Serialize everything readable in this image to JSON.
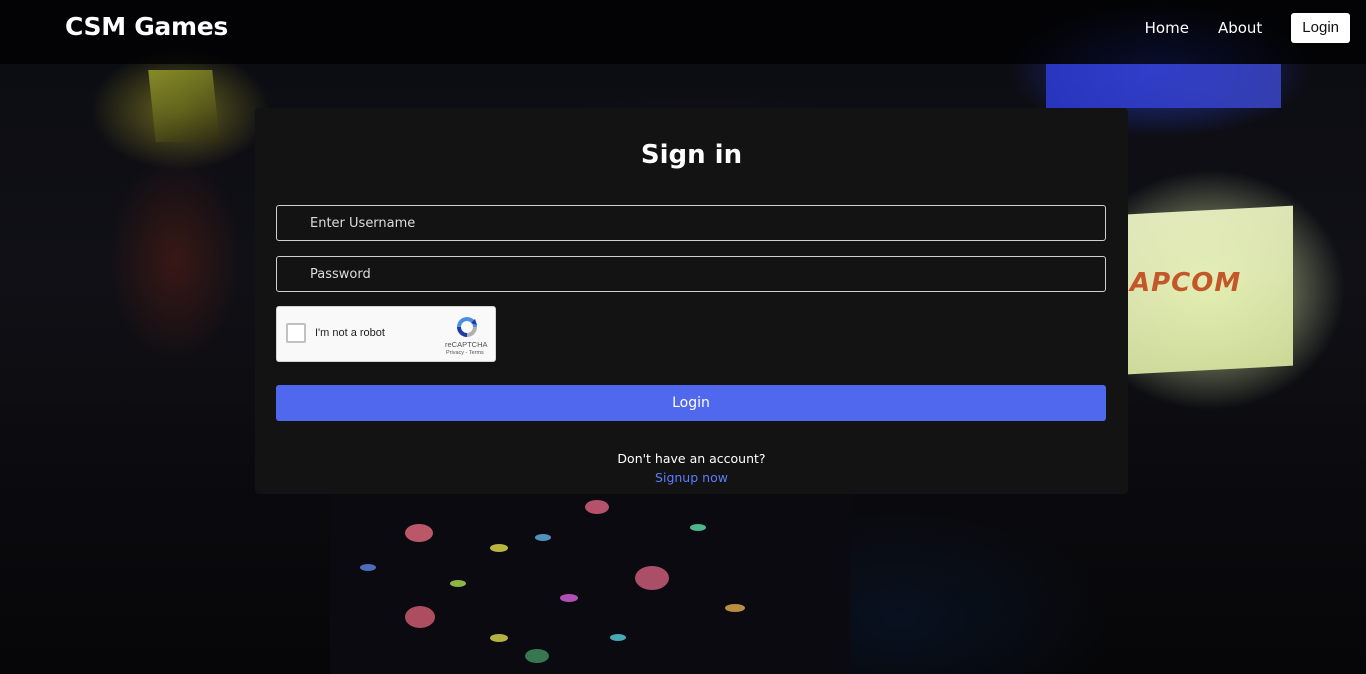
{
  "navbar": {
    "brand": "CSM Games",
    "links": [
      {
        "label": "Home"
      },
      {
        "label": "About"
      }
    ],
    "login_button": "Login"
  },
  "background": {
    "screen_text": "APCOM"
  },
  "signin": {
    "title": "Sign in",
    "username": {
      "value": "",
      "placeholder": "Enter Username"
    },
    "password": {
      "value": "",
      "placeholder": "Password"
    },
    "recaptcha": {
      "checkbox_label": "I'm not a robot",
      "brand": "reCAPTCHA",
      "links": "Privacy - Terms"
    },
    "login_button": "Login",
    "no_account_text": "Don't have an account?",
    "signup_link": "Signup now"
  },
  "colors": {
    "accent": "#5068ee",
    "link": "#5a7dff",
    "card_bg": "#131313"
  }
}
